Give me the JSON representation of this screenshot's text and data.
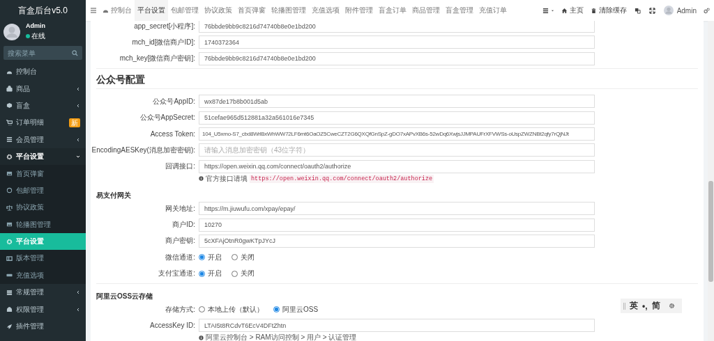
{
  "sidebar": {
    "logo": "盲盒后台v5.0",
    "user": {
      "name": "Admin",
      "status": "在线"
    },
    "search": {
      "placeholder": "搜索菜单"
    },
    "menu": [
      {
        "label": "控制台",
        "selected": false
      },
      {
        "label": "商品",
        "expanded": false,
        "selected": false
      },
      {
        "label": "盲盒",
        "expanded": false,
        "selected": false
      },
      {
        "label": "订单明细",
        "badge": "新",
        "selected": false
      },
      {
        "label": "会员管理",
        "expanded": false,
        "selected": false
      },
      {
        "label": "平台设置",
        "expanded": true,
        "selected": false,
        "children": [
          {
            "label": "首页弹窗",
            "selected": false
          },
          {
            "label": "包邮管理",
            "selected": false
          },
          {
            "label": "协议政策",
            "selected": false
          },
          {
            "label": "轮播图管理",
            "selected": false
          },
          {
            "label": "平台设置",
            "selected": true
          },
          {
            "label": "版本管理",
            "selected": false
          },
          {
            "label": "充值选项",
            "selected": false
          }
        ]
      },
      {
        "label": "常规管理",
        "expanded": false,
        "selected": false
      },
      {
        "label": "权限管理",
        "expanded": false,
        "selected": false
      },
      {
        "label": "插件管理",
        "selected": false
      }
    ]
  },
  "topbar": {
    "tabs": [
      {
        "label": "控制台",
        "selected": false
      },
      {
        "label": "平台设置",
        "selected": true
      },
      {
        "label": "包邮管理",
        "selected": false
      },
      {
        "label": "协议政策",
        "selected": false
      },
      {
        "label": "首页弹窗",
        "selected": false
      },
      {
        "label": "轮播图管理",
        "selected": false
      },
      {
        "label": "充值选项",
        "selected": false
      },
      {
        "label": "附件管理",
        "selected": false
      },
      {
        "label": "盲盒订单",
        "selected": false
      },
      {
        "label": "商品管理",
        "selected": false
      },
      {
        "label": "盲盒管理",
        "selected": false
      },
      {
        "label": "充值订单",
        "selected": false
      }
    ],
    "home": "主页",
    "clear_cache": "清除缓存",
    "user": "Admin"
  },
  "sections": [
    {
      "rows": [
        {
          "kind": "field",
          "label": "app_secret[小程序]:",
          "value": "76bbde9bb9c8216d74740b8e0e1bd200"
        },
        {
          "kind": "field",
          "label": "mch_id[微信商户ID]:",
          "value": "1740372364"
        },
        {
          "kind": "field",
          "label": "mch_key[微信商户密钥]:",
          "value": "76bbde9bb9c8216d74740b8e0e1bd200"
        }
      ]
    },
    {
      "title": "公众号配置",
      "kind": "heading",
      "rows": [
        {
          "kind": "field",
          "label": "公众号AppID:",
          "value": "wx87de17b8b001d5ab"
        },
        {
          "kind": "field",
          "label": "公众号AppSecret:",
          "value": "51cefae965d512881a32a561016e7345"
        },
        {
          "kind": "field",
          "label": "Access Token:",
          "value": "104_U5xmo-S7_cbd8WrlBxWhWW72LF6mt6OaOZ5CweCZT2G6QXQfGnSpZ-gDO7xAPvXB6s-52wDq6XwjsJJMPAUFrXFVWSs-oUspZWZNBt2qfy7rQjNJt"
        },
        {
          "kind": "field",
          "label": "EncodingAESKey(消息加密密钥):",
          "placeholder": "请输入消息加密密钥（43位字符）"
        },
        {
          "kind": "field",
          "label": "回调接口:",
          "value": "https://open.weixin.qq.com/connect/oauth2/authorize"
        },
        {
          "kind": "help",
          "text": "官方接口请填",
          "code": "https://open.weixin.qq.com/connect/oauth2/authorize"
        }
      ]
    },
    {
      "title": "易支付网关",
      "kind": "subheading",
      "rows": [
        {
          "kind": "field",
          "label": "网关地址:",
          "value": "https://m.jiuwufu.com/xpay/epay/"
        },
        {
          "kind": "field",
          "label": "商户ID:",
          "value": "10270"
        },
        {
          "kind": "field",
          "label": "商户密钥:",
          "value": "5cXFAjOtnR0gwKTpJYcJ"
        },
        {
          "kind": "radio",
          "label": "微信通道:",
          "options": [
            {
              "label": "开启",
              "selected": true
            },
            {
              "label": "关闭",
              "selected": false
            }
          ]
        },
        {
          "kind": "radio",
          "label": "支付宝通道:",
          "options": [
            {
              "label": "开启",
              "selected": true
            },
            {
              "label": "关闭",
              "selected": false
            }
          ]
        }
      ]
    },
    {
      "title": "阿里云OSS云存储",
      "kind": "subheading",
      "rows": [
        {
          "kind": "radio",
          "label": "存储方式:",
          "options": [
            {
              "label": "本地上传（默认）",
              "selected": false
            },
            {
              "label": "阿里云OSS",
              "selected": true
            }
          ]
        },
        {
          "kind": "field",
          "label": "AccessKey ID:",
          "value": "LTAI5t8RCdvT6EcV4DFtZhtn"
        },
        {
          "kind": "help",
          "text": "阿里云控制台 > RAM访问控制 > 用户 > 认证管理"
        }
      ]
    }
  ],
  "ime_toolbar": {
    "items": [
      "英",
      "•,",
      "简"
    ]
  }
}
